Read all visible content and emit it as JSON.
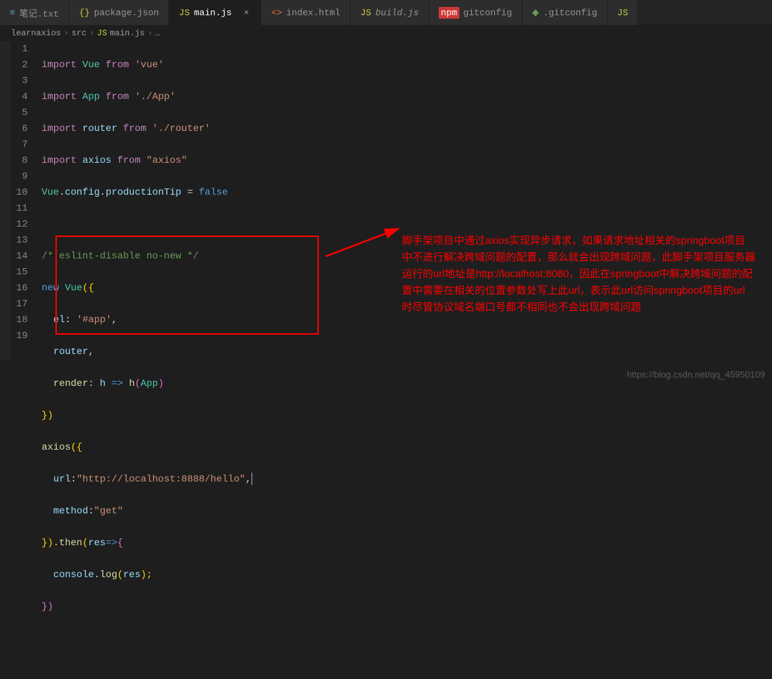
{
  "tabs": [
    {
      "icon": "≡",
      "iconClass": "ico-txt",
      "label": "笔记.txt"
    },
    {
      "icon": "{}",
      "iconClass": "ico-json",
      "label": "package.json"
    },
    {
      "icon": "JS",
      "iconClass": "ico-js",
      "label": "main.js",
      "active": true,
      "close": "×"
    },
    {
      "icon": "<>",
      "iconClass": "ico-html",
      "label": "index.html"
    },
    {
      "icon": "JS",
      "iconClass": "ico-js",
      "label": "build.js",
      "italic": true
    },
    {
      "icon": "npm",
      "iconClass": "ico-npm",
      "label": "gitconfig"
    },
    {
      "icon": "◆",
      "iconClass": "ico-gitconfig",
      "label": ".gitconfig"
    },
    {
      "icon": "JS",
      "iconClass": "ico-js",
      "label": ""
    }
  ],
  "breadcrumb": {
    "part1": "learnaxios",
    "part2": "src",
    "icon": "JS",
    "part3": "main.js",
    "more": "…"
  },
  "lines": [
    "1",
    "2",
    "3",
    "4",
    "5",
    "6",
    "7",
    "8",
    "9",
    "10",
    "11",
    "12",
    "13",
    "14",
    "15",
    "16",
    "17",
    "18",
    "19"
  ],
  "code": {
    "l1": {
      "import": "import",
      "Vue": "Vue",
      "from": "from",
      "str": "'vue'"
    },
    "l2": {
      "import": "import",
      "App": "App",
      "from": "from",
      "str": "'./App'"
    },
    "l3": {
      "import": "import",
      "router": "router",
      "from": "from",
      "str": "'./router'"
    },
    "l4": {
      "import": "import",
      "axios": "axios",
      "from": "from",
      "str": "\"axios\""
    },
    "l5": {
      "Vue": "Vue",
      "dot1": ".",
      "config": "config",
      "dot2": ".",
      "tip": "productionTip",
      "eq": " = ",
      "val": "false"
    },
    "l7": {
      "cmt": "/* eslint-disable no-new */"
    },
    "l8": {
      "new": "new",
      "Vue": "Vue",
      "open": "({"
    },
    "l9": {
      "el": "el",
      "colon": ": ",
      "str": "'#app'",
      "comma": ","
    },
    "l10": {
      "router": "router",
      "comma": ","
    },
    "l11": {
      "render": "render",
      "colon": ": ",
      "h": "h",
      "arrow": " => ",
      "fn": "h",
      "open": "(",
      "App": "App",
      "close": ")"
    },
    "l12": {
      "close": "})"
    },
    "l13": {
      "axios": "axios",
      "open": "({"
    },
    "l14": {
      "url": "url",
      "colon": ":",
      "str": "\"http://localhost:8888/hello\"",
      "comma": ","
    },
    "l15": {
      "method": "method",
      "colon": ":",
      "str": "\"get\""
    },
    "l16": {
      "close": "}).",
      "then": "then",
      "open": "(",
      "res": "res",
      "arrow": "=>",
      "brace": "{"
    },
    "l17": {
      "console": "console",
      "dot": ".",
      "log": "log",
      "open": "(",
      "res": "res",
      "close": ");"
    },
    "l18": {
      "close": "})"
    }
  },
  "annotation": "脚手架项目中通过axios实现异步请求，如果请求地址相关的springboot项目中不进行解决跨域问题的配置，那么就会出现跨域问题，此脚手架项目服务器运行的url地址是http://localhost:8080，因此在springboot中解决跨域问题的配置中需要在相关的位置参数处写上此url，表示此url访问springboot项目的url时尽管协议域名端口号都不相同也不会出现跨域问题",
  "watermark": "https://blog.csdn.net/qq_45950109"
}
